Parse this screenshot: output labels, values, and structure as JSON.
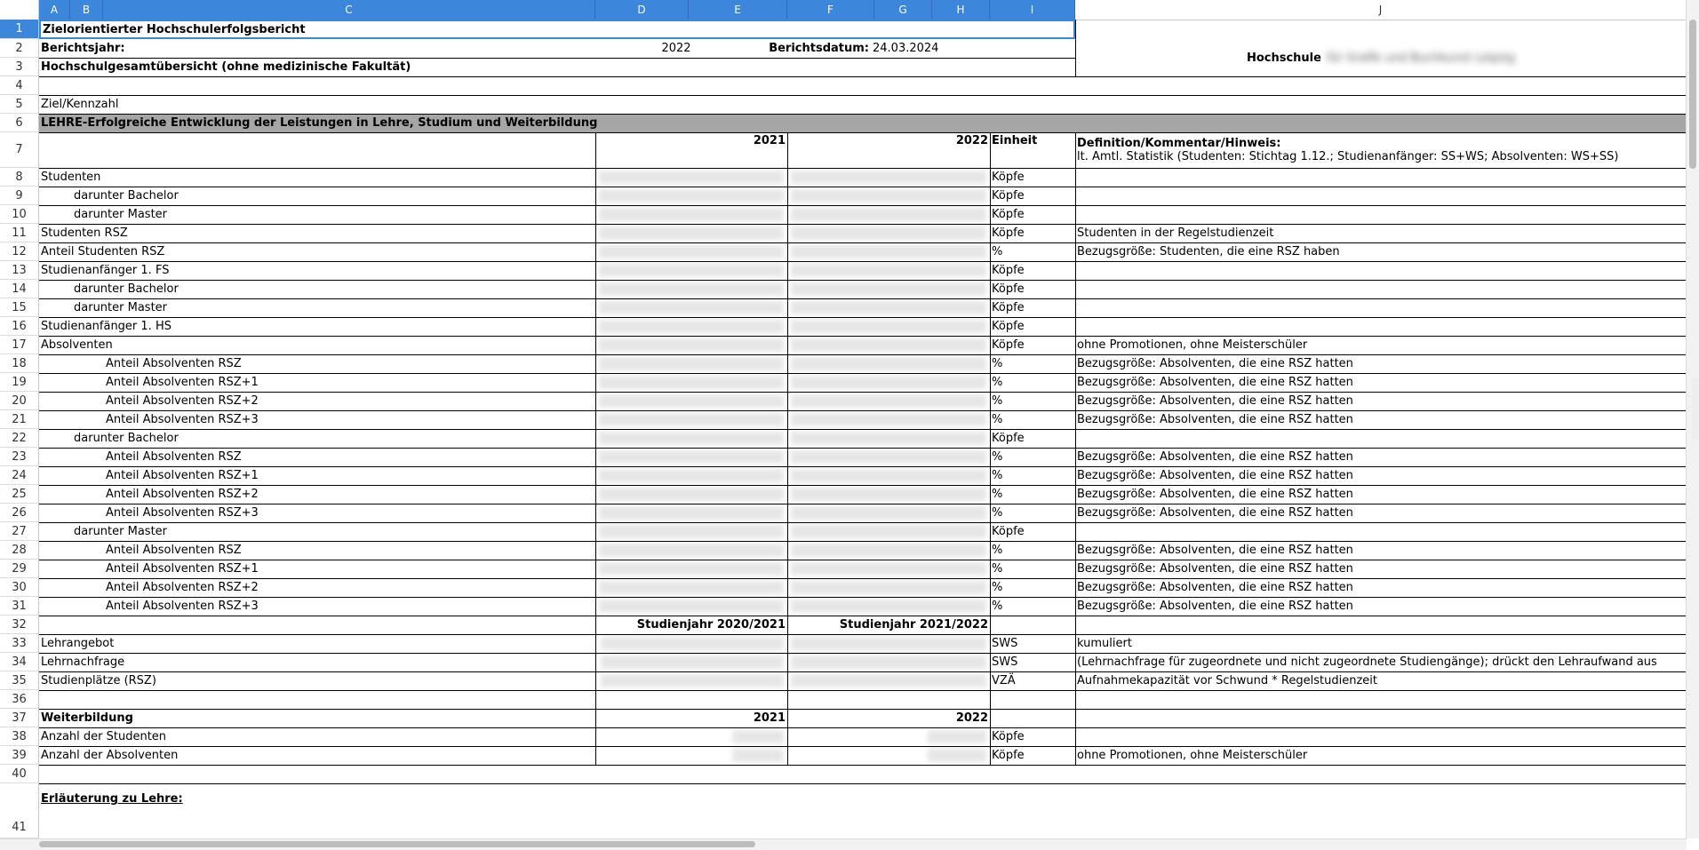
{
  "columns": [
    "A",
    "B",
    "C",
    "D",
    "E",
    "F",
    "G",
    "H",
    "I",
    "J"
  ],
  "rows": [
    "1",
    "2",
    "3",
    "4",
    "5",
    "6",
    "7",
    "8",
    "9",
    "10",
    "11",
    "12",
    "13",
    "14",
    "15",
    "16",
    "17",
    "18",
    "19",
    "20",
    "21",
    "22",
    "23",
    "24",
    "25",
    "26",
    "27",
    "28",
    "29",
    "30",
    "31",
    "32",
    "33",
    "34",
    "35",
    "36",
    "37",
    "38",
    "39",
    "40",
    "41"
  ],
  "header": {
    "title": "Zielorientierter Hochschulerfolgsbericht",
    "berichtsjahr_label": "Berichtsjahr:",
    "berichtsjahr": "2022",
    "berichtsdatum_label": "Berichtsdatum:",
    "berichtsdatum": "24.03.2024",
    "hochschule_label": "Hochschule",
    "hochschule_name": "für Grafik und Buchkunst Leipzig",
    "subtitle": "Hochschulgesamtübersicht (ohne medizinische Fakultät)",
    "ziel_label": "Ziel/Kennzahl",
    "section_lehre": "LEHRE-Erfolgreiche Entwicklung der Leistungen in Lehre, Studium und Weiterbildung"
  },
  "table_header": {
    "y1": "2021",
    "y2": "2022",
    "unit": "Einheit",
    "def_title": "Definition/Kommentar/Hinweis:",
    "def_text": "lt. Amtl. Statistik (Studenten: Stichtag 1.12.; Studienanfänger: SS+WS; Absolventen: WS+SS)"
  },
  "data_rows": [
    {
      "label": "Studenten",
      "indent": 0,
      "unit": "Köpfe",
      "comment": ""
    },
    {
      "label": "darunter Bachelor",
      "indent": 1,
      "unit": "Köpfe",
      "comment": ""
    },
    {
      "label": "darunter Master",
      "indent": 1,
      "unit": "Köpfe",
      "comment": ""
    },
    {
      "label": "Studenten RSZ",
      "indent": 0,
      "unit": "Köpfe",
      "comment": "Studenten in der Regelstudienzeit"
    },
    {
      "label": "Anteil Studenten RSZ",
      "indent": 0,
      "unit": "%",
      "comment": "Bezugsgröße: Studenten, die eine RSZ haben"
    },
    {
      "label": "Studienanfänger 1. FS",
      "indent": 0,
      "unit": "Köpfe",
      "comment": ""
    },
    {
      "label": "darunter Bachelor",
      "indent": 1,
      "unit": "Köpfe",
      "comment": ""
    },
    {
      "label": "darunter Master",
      "indent": 1,
      "unit": "Köpfe",
      "comment": ""
    },
    {
      "label": "Studienanfänger 1. HS",
      "indent": 0,
      "unit": "Köpfe",
      "comment": ""
    },
    {
      "label": "Absolventen",
      "indent": 0,
      "unit": "Köpfe",
      "comment": "ohne Promotionen, ohne Meisterschüler"
    },
    {
      "label": "Anteil Absolventen RSZ",
      "indent": 2,
      "unit": "%",
      "comment": "Bezugsgröße: Absolventen, die eine RSZ hatten"
    },
    {
      "label": "Anteil Absolventen RSZ+1",
      "indent": 2,
      "unit": "%",
      "comment": "Bezugsgröße: Absolventen, die eine RSZ hatten"
    },
    {
      "label": "Anteil Absolventen RSZ+2",
      "indent": 2,
      "unit": "%",
      "comment": "Bezugsgröße: Absolventen, die eine RSZ hatten"
    },
    {
      "label": "Anteil Absolventen RSZ+3",
      "indent": 2,
      "unit": "%",
      "comment": "Bezugsgröße: Absolventen, die eine RSZ hatten"
    },
    {
      "label": "darunter Bachelor",
      "indent": 1,
      "unit": "Köpfe",
      "comment": ""
    },
    {
      "label": "Anteil Absolventen RSZ",
      "indent": 2,
      "unit": "%",
      "comment": "Bezugsgröße: Absolventen, die eine RSZ hatten"
    },
    {
      "label": "Anteil Absolventen RSZ+1",
      "indent": 2,
      "unit": "%",
      "comment": "Bezugsgröße: Absolventen, die eine RSZ hatten"
    },
    {
      "label": "Anteil Absolventen RSZ+2",
      "indent": 2,
      "unit": "%",
      "comment": "Bezugsgröße: Absolventen, die eine RSZ hatten"
    },
    {
      "label": "Anteil Absolventen RSZ+3",
      "indent": 2,
      "unit": "%",
      "comment": "Bezugsgröße: Absolventen, die eine RSZ hatten"
    },
    {
      "label": "darunter Master",
      "indent": 1,
      "unit": "Köpfe",
      "comment": ""
    },
    {
      "label": "Anteil Absolventen RSZ",
      "indent": 2,
      "unit": "%",
      "comment": "Bezugsgröße: Absolventen, die eine RSZ hatten"
    },
    {
      "label": "Anteil Absolventen RSZ+1",
      "indent": 2,
      "unit": "%",
      "comment": "Bezugsgröße: Absolventen, die eine RSZ hatten"
    },
    {
      "label": "Anteil Absolventen RSZ+2",
      "indent": 2,
      "unit": "%",
      "comment": "Bezugsgröße: Absolventen, die eine RSZ hatten"
    },
    {
      "label": "Anteil Absolventen RSZ+3",
      "indent": 2,
      "unit": "%",
      "comment": "Bezugsgröße: Absolventen, die eine RSZ hatten"
    }
  ],
  "studienjahr": {
    "y1": "Studienjahr 2020/2021",
    "y2": "Studienjahr 2021/2022"
  },
  "lehre_rows": [
    {
      "label": "Lehrangebot",
      "unit": "SWS",
      "comment": "kumuliert"
    },
    {
      "label": "Lehrnachfrage",
      "unit": "SWS",
      "comment": "(Lehrnachfrage für zugeordnete und nicht zugeordnete Studiengänge); drückt den Lehraufwand aus"
    },
    {
      "label": "Studienplätze (RSZ)",
      "unit": "VZÄ",
      "comment": "Aufnahmekapazität vor Schwund * Regelstudienzeit"
    }
  ],
  "weiterbildung": {
    "title": "Weiterbildung",
    "y1": "2021",
    "y2": "2022",
    "rows": [
      {
        "label": "Anzahl der Studenten",
        "unit": "Köpfe",
        "comment": ""
      },
      {
        "label": "Anzahl der Absolventen",
        "unit": "Köpfe",
        "comment": "ohne Promotionen, ohne Meisterschüler"
      }
    ]
  },
  "erlaeuterung": "Erläuterung zu Lehre:",
  "colors": {
    "selection": "#3c86dc",
    "section_bg": "#a6a6a6"
  }
}
